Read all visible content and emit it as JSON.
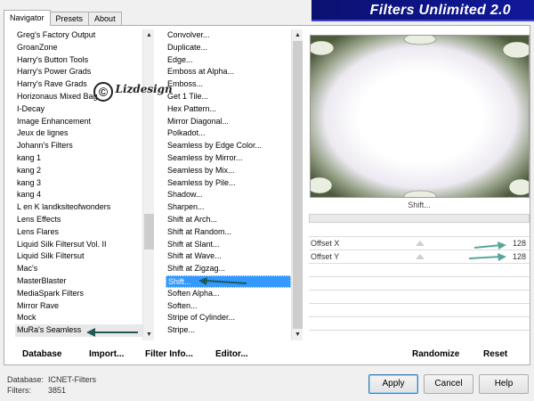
{
  "tabs": [
    "Navigator",
    "Presets",
    "About"
  ],
  "banner_title": "Filters Unlimited 2.0",
  "categories": [
    "Greg's Factory Output",
    "GroanZone",
    "Harry's Button Tools",
    "Harry's Power Grads",
    "Harry's Rave Grads",
    "Horizonaus Mixed Bag",
    "I-Decay",
    "Image Enhancement",
    "Jeux de lignes",
    "Johann's Filters",
    "kang 1",
    "kang 2",
    "kang 3",
    "kang 4",
    "L en K landksiteofwonders",
    "Lens Effects",
    "Lens Flares",
    "Liquid Silk Filtersut Vol. II",
    "Liquid Silk Filtersut",
    "Mac's",
    "MasterBlaster",
    "MediaSpark Filters",
    "Mirror Rave",
    "Mock",
    "MuRa's Seamless"
  ],
  "filters": [
    "Convolver...",
    "Duplicate...",
    "Edge...",
    "Emboss at Alpha...",
    "Emboss...",
    "Get 1 Tile...",
    "Hex Pattern...",
    "Mirror Diagonal...",
    "Polkadot...",
    "Seamless by Edge Color...",
    "Seamless by Mirror...",
    "Seamless by Mix...",
    "Seamless by Pile...",
    "Shadow...",
    "Sharpen...",
    "Shift at Arch...",
    "Shift at Random...",
    "Shift at Slant...",
    "Shift at Wave...",
    "Shift at Zigzag...",
    "Shift...",
    "Soften Alpha...",
    "Soften...",
    "Stripe of Cylinder...",
    "Stripe..."
  ],
  "watermark": "Lizdesign",
  "watermark_symbol": "©",
  "link_buttons": {
    "database": "Database",
    "import": "Import...",
    "filter_info": "Filter Info...",
    "editor": "Editor..."
  },
  "selected_filter_name": "Shift...",
  "params": [
    {
      "label": "Offset X",
      "value": "128"
    },
    {
      "label": "Offset Y",
      "value": "128"
    }
  ],
  "right_buttons": {
    "randomize": "Randomize",
    "reset": "Reset"
  },
  "status": {
    "database_label": "Database:",
    "database_value": "ICNET-Filters",
    "filters_label": "Filters:",
    "filters_value": "3851"
  },
  "dialog_buttons": {
    "apply": "Apply",
    "cancel": "Cancel",
    "help": "Help"
  },
  "colors": {
    "banner": "#10189a",
    "selection": "#3399ff",
    "arrow": "#1e5a56"
  }
}
